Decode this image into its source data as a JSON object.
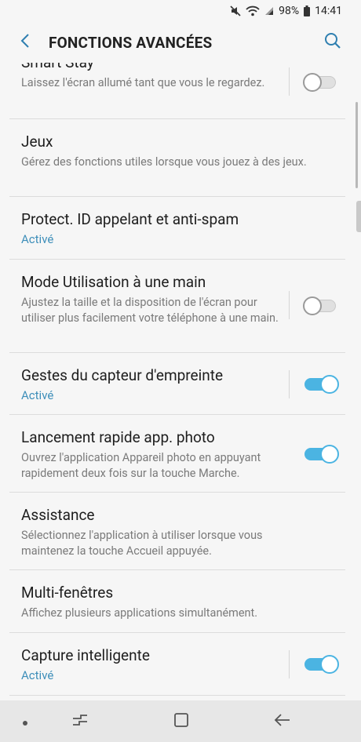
{
  "status_bar": {
    "battery": "98%",
    "time": "14:41",
    "icons": [
      "mute-icon",
      "wifi-icon",
      "signal-icon",
      "battery-icon"
    ]
  },
  "header": {
    "title": "FONCTIONS AVANCÉES",
    "back_icon": "back-chevron-icon",
    "search_icon": "search-icon"
  },
  "items": [
    {
      "title": "Smart Stay",
      "subtitle": "Laissez l'écran allumé tant que vous le regardez.",
      "toggle": "off"
    },
    {
      "title": "Jeux",
      "subtitle": "Gérez des fonctions utiles lorsque vous jouez à des jeux."
    },
    {
      "title": "Protect. ID appelant et anti-spam",
      "status": "Activé"
    },
    {
      "title": "Mode Utilisation à une main",
      "subtitle": "Ajustez la taille et la disposition de l'écran pour utiliser plus facilement votre téléphone à une main.",
      "toggle": "off"
    },
    {
      "title": "Gestes du capteur d'empreinte",
      "status": "Activé",
      "toggle": "on"
    },
    {
      "title": "Lancement rapide app. photo",
      "subtitle": "Ouvrez l'application Appareil photo en appuyant rapidement deux fois sur la touche Marche.",
      "toggle": "on"
    },
    {
      "title": "Assistance",
      "subtitle": "Sélectionnez l'application à utiliser lorsque vous maintenez la touche Accueil appuyée."
    },
    {
      "title": "Multi-fenêtres",
      "subtitle": "Affichez plusieurs applications simultanément."
    },
    {
      "title": "Capture intelligente",
      "status": "Activé",
      "toggle": "on"
    }
  ],
  "nav_bar": {
    "buttons": [
      "dot-icon",
      "recents-icon",
      "home-icon",
      "back-icon"
    ]
  },
  "colors": {
    "accent": "#3d8eb9",
    "toggle_on": "#4bb4e2",
    "background": "#f6f6f6",
    "nav_background": "#e7e7e7"
  }
}
